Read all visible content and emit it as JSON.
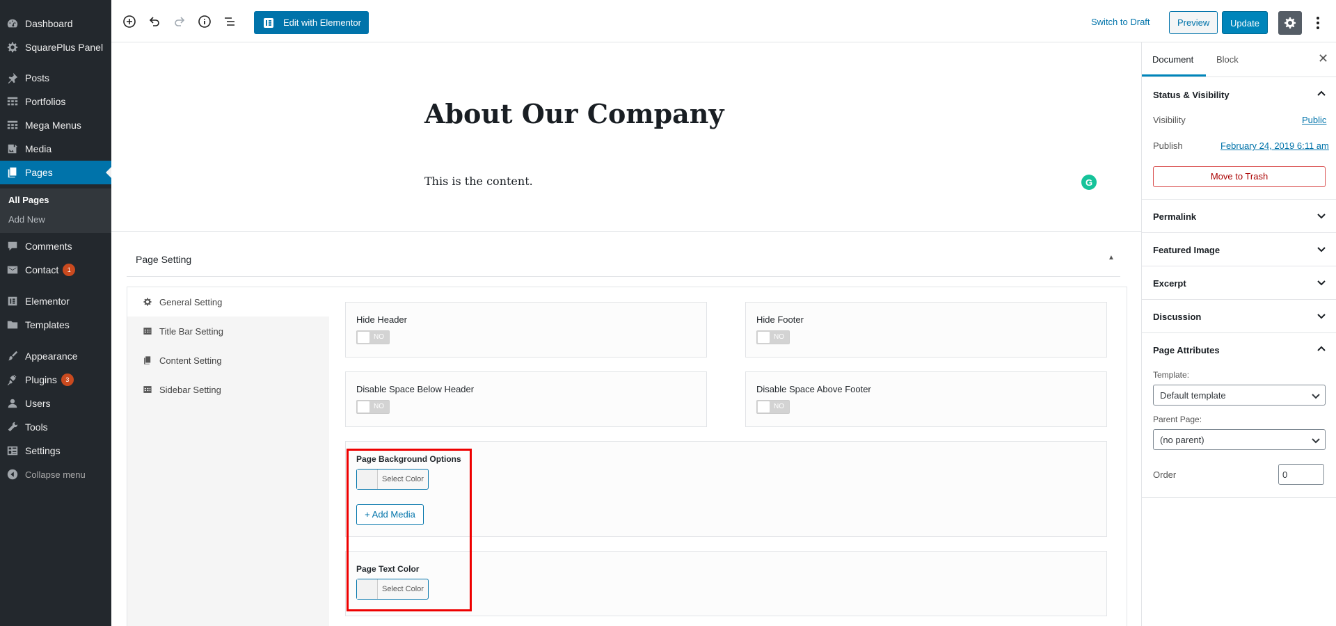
{
  "admin_menu": {
    "items": [
      {
        "label": "Dashboard",
        "icon": "dashboard-icon"
      },
      {
        "label": "SquarePlus Panel",
        "icon": "gear-icon"
      },
      {
        "label": "Posts",
        "icon": "pin-icon"
      },
      {
        "label": "Portfolios",
        "icon": "grid-icon"
      },
      {
        "label": "Mega Menus",
        "icon": "grid-icon"
      },
      {
        "label": "Media",
        "icon": "media-icon"
      },
      {
        "label": "Pages",
        "icon": "pages-icon"
      },
      {
        "label": "Comments",
        "icon": "comment-icon"
      },
      {
        "label": "Contact",
        "icon": "envelope-icon",
        "badge": "1"
      },
      {
        "label": "Elementor",
        "icon": "elementor-icon"
      },
      {
        "label": "Templates",
        "icon": "folder-icon"
      },
      {
        "label": "Appearance",
        "icon": "brush-icon"
      },
      {
        "label": "Plugins",
        "icon": "plug-icon",
        "badge": "3"
      },
      {
        "label": "Users",
        "icon": "user-icon"
      },
      {
        "label": "Tools",
        "icon": "wrench-icon"
      },
      {
        "label": "Settings",
        "icon": "settings-icon"
      },
      {
        "label": "Collapse menu",
        "icon": "collapse-icon"
      }
    ],
    "submenu": [
      "All Pages",
      "Add New"
    ]
  },
  "toolbar": {
    "elementor_label": "Edit with Elementor",
    "switch_to_draft": "Switch to Draft",
    "preview": "Preview",
    "update": "Update"
  },
  "editor": {
    "title": "About Our Company",
    "content": "This is the content.",
    "grammarly_letter": "G"
  },
  "metabox": {
    "title": "Page Setting",
    "tabs": [
      "General Setting",
      "Title Bar Setting",
      "Content Setting",
      "Sidebar Setting"
    ],
    "settings": {
      "hide_header": "Hide Header",
      "hide_footer": "Hide Footer",
      "disable_space_below_header": "Disable Space Below Header",
      "disable_space_above_footer": "Disable Space Above Footer",
      "toggle_off": "NO",
      "page_background_options": "Page Background Options",
      "select_color": "Select Color",
      "add_media": "+ Add Media",
      "page_text_color": "Page Text Color"
    }
  },
  "sidebar": {
    "tabs": [
      "Document",
      "Block"
    ],
    "close": "✕",
    "status_visibility": {
      "title": "Status & Visibility",
      "visibility_label": "Visibility",
      "visibility_value": "Public",
      "publish_label": "Publish",
      "publish_value": "February 24, 2019 6:11 am",
      "trash": "Move to Trash"
    },
    "sections": [
      "Permalink",
      "Featured Image",
      "Excerpt",
      "Discussion"
    ],
    "page_attributes": {
      "title": "Page Attributes",
      "template_label": "Template:",
      "template_value": "Default template",
      "parent_label": "Parent Page:",
      "parent_value": "(no parent)",
      "order_label": "Order",
      "order_value": "0"
    }
  },
  "colors": {
    "admin_bg": "#23282d",
    "accent": "#0073aa",
    "badge": "#ca4a1f",
    "highlight": "#ee0000"
  }
}
